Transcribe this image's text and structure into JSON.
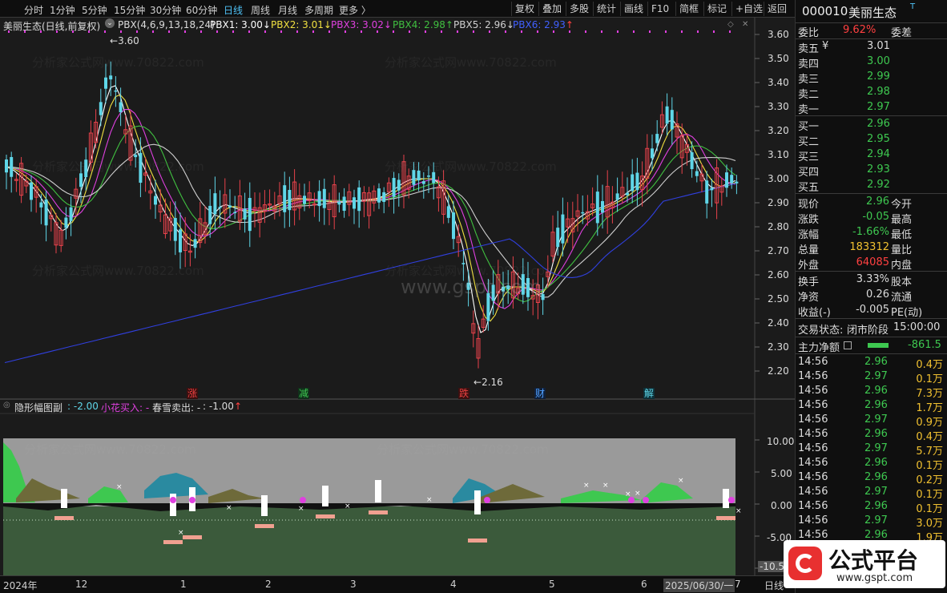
{
  "colors": {
    "up": "#e8424b",
    "down": "#5fd6e8",
    "ma1": "#ffffff",
    "ma2": "#f0e040",
    "ma3": "#e040e0",
    "ma4": "#40c040",
    "ma5": "#d0d0d0",
    "ma6": "#3040e0",
    "green": "#3ec850",
    "red": "#ff4040",
    "yellow": "#f0c030",
    "blue_accent": "#4fc3f7"
  },
  "toolbar": {
    "periods": [
      {
        "label": "分时",
        "active": false
      },
      {
        "label": "1分钟",
        "active": false
      },
      {
        "label": "5分钟",
        "active": false
      },
      {
        "label": "15分钟",
        "active": false
      },
      {
        "label": "30分钟",
        "active": false
      },
      {
        "label": "60分钟",
        "active": false
      },
      {
        "label": "日线",
        "active": true
      },
      {
        "label": "周线",
        "active": false
      },
      {
        "label": "月线",
        "active": false
      },
      {
        "label": "多周期",
        "active": false
      },
      {
        "label": "更多 〉",
        "active": false
      }
    ],
    "buttons": [
      "复权",
      "叠加",
      "多股",
      "统计",
      "画线",
      "F10",
      "简框",
      "标记",
      "+自选",
      "返回"
    ]
  },
  "main_legend": {
    "title": "美丽生态(日线,前复权)",
    "icon": "chevron-down-icon",
    "formula": "PBX(4,6,9,13,18,24)",
    "items": [
      {
        "label": "PBX1: 3.00",
        "arrow": "↓",
        "color": "#ffffff"
      },
      {
        "label": "PBX2: 3.01",
        "arrow": "↓",
        "color": "#f0e040"
      },
      {
        "label": "PBX3: 3.02",
        "arrow": "↓",
        "color": "#e040e0"
      },
      {
        "label": "PBX4: 2.98",
        "arrow": "↑",
        "color": "#40c040"
      },
      {
        "label": "PBX5: 2.96",
        "arrow": "↓",
        "color": "#d0d0d0"
      },
      {
        "label": "PBX6: 2.93",
        "arrow": "↑",
        "color": "#4060ff"
      }
    ]
  },
  "sub_legend": {
    "title": "隐形幅图副",
    "value1": "-2.00",
    "item2": "小花买入:",
    "item2_val": "-",
    "item3": "春雪卖出:",
    "item3_val": "-",
    "item4": ":",
    "item4_val": "-1.00",
    "arrow": "↑"
  },
  "price_axis": [
    "3.60",
    "3.50",
    "3.40",
    "3.30",
    "3.20",
    "3.10",
    "3.00",
    "2.90",
    "2.80",
    "2.70",
    "2.60",
    "2.50",
    "2.40",
    "2.30",
    "2.20"
  ],
  "sub_axis": [
    "10.00",
    "5.00",
    "0.00",
    "-5.00",
    "-10.5"
  ],
  "annotations": {
    "high": "3.60",
    "low": "2.16",
    "high_arrow": "←",
    "low_arrow": "←"
  },
  "event_markers": [
    {
      "label": "涨",
      "color": "#e84040"
    },
    {
      "label": "减",
      "color": "#3ec850"
    },
    {
      "label": "跌",
      "color": "#e84040"
    },
    {
      "label": "财",
      "color": "#4fa0ff"
    },
    {
      "label": "解",
      "color": "#5fd6e8"
    }
  ],
  "date_axis": [
    "2024年",
    "12",
    "1",
    "2",
    "3",
    "4",
    "5",
    "6",
    "2025/06/30/一",
    "7"
  ],
  "bottom_label": "日线",
  "watermarks": {
    "site": "www.gspt.com",
    "formula": "分析家公式网www.70822.com"
  },
  "logo": {
    "text": "公式平台",
    "url": "www.gspt.com"
  },
  "panel": {
    "header": {
      "code": "000010",
      "name": "美丽生态",
      "flag": "T"
    },
    "weibi": {
      "label": "委比",
      "value": "9.62%",
      "label2": "委差"
    },
    "sell": [
      {
        "label": "卖五",
        "extra": "¥",
        "price": "3.01"
      },
      {
        "label": "卖四",
        "extra": "",
        "price": "3.00"
      },
      {
        "label": "卖三",
        "extra": "",
        "price": "2.99"
      },
      {
        "label": "卖二",
        "extra": "",
        "price": "2.98"
      },
      {
        "label": "卖一",
        "extra": "",
        "price": "2.97"
      }
    ],
    "buy": [
      {
        "label": "买一",
        "price": "2.96"
      },
      {
        "label": "买二",
        "price": "2.95"
      },
      {
        "label": "买三",
        "price": "2.94"
      },
      {
        "label": "买四",
        "price": "2.93"
      },
      {
        "label": "买五",
        "price": "2.92"
      }
    ],
    "stats": [
      {
        "l": "现价",
        "v": "2.96",
        "vc": "#3ec850",
        "r": "今开"
      },
      {
        "l": "涨跌",
        "v": "-0.05",
        "vc": "#3ec850",
        "r": "最高"
      },
      {
        "l": "涨幅",
        "v": "-1.66%",
        "vc": "#3ec850",
        "r": "最低"
      },
      {
        "l": "总量",
        "v": "183312",
        "vc": "#f0c030",
        "r": "量比"
      },
      {
        "l": "外盘",
        "v": "64085",
        "vc": "#ff4040",
        "r": "内盘"
      }
    ],
    "stats2": [
      {
        "l": "换手",
        "v": "3.33%",
        "vc": "#dcdcdc",
        "r": "股本"
      },
      {
        "l": "净资",
        "v": "0.26",
        "vc": "#dcdcdc",
        "r": "流通"
      },
      {
        "l": "收益(-)",
        "v": "-0.005",
        "vc": "#dcdcdc",
        "r": "PE(动)"
      }
    ],
    "trade_state": {
      "label": "交易状态:",
      "state": "闭市阶段",
      "time": "15:00:00"
    },
    "main_net": {
      "label": "主力净额",
      "value": "-861.5"
    },
    "ticks": [
      {
        "t": "14:56",
        "p": "2.96",
        "v": "0.4万"
      },
      {
        "t": "14:56",
        "p": "2.97",
        "v": "0.1万"
      },
      {
        "t": "14:56",
        "p": "2.96",
        "v": "7.3万"
      },
      {
        "t": "14:56",
        "p": "2.96",
        "v": "1.7万"
      },
      {
        "t": "14:56",
        "p": "2.97",
        "v": "0.9万"
      },
      {
        "t": "14:56",
        "p": "2.96",
        "v": "0.4万"
      },
      {
        "t": "14:56",
        "p": "2.97",
        "v": "5.7万"
      },
      {
        "t": "14:56",
        "p": "2.96",
        "v": "0.1万"
      },
      {
        "t": "14:56",
        "p": "2.96",
        "v": "0.2万"
      },
      {
        "t": "14:56",
        "p": "2.97",
        "v": "0.1万"
      },
      {
        "t": "14:56",
        "p": "2.96",
        "v": "0.1万"
      },
      {
        "t": "14:56",
        "p": "2.97",
        "v": "3.0万"
      },
      {
        "t": "14:56",
        "p": "2.96",
        "v": "1.9万"
      }
    ]
  }
}
